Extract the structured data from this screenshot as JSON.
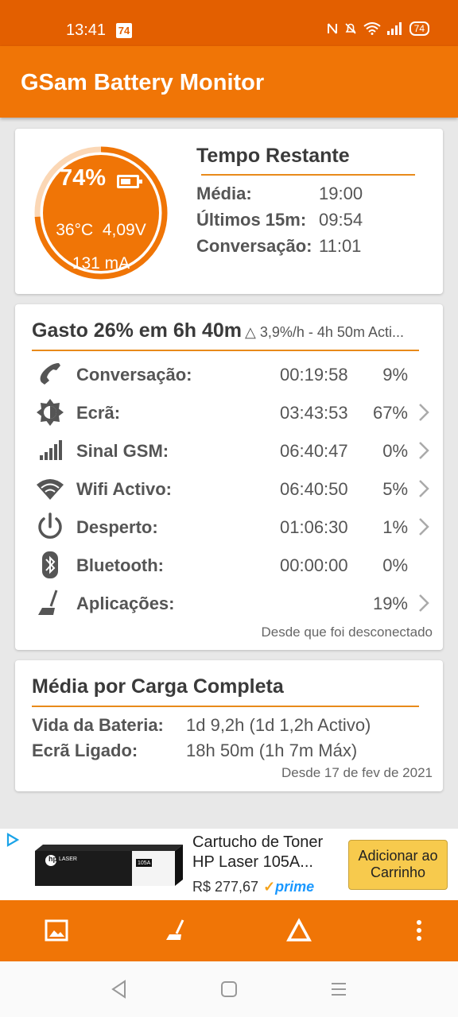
{
  "status_bar": {
    "time": "13:41",
    "badge": "74",
    "battery": "74"
  },
  "app_bar": {
    "title": "GSam Battery Monitor"
  },
  "battery_card": {
    "percent": "74%",
    "temp_voltage": "36°C  4,09V",
    "current": "131 mA",
    "level": 0.74,
    "time_remaining": {
      "title": "Tempo Restante",
      "rows": [
        {
          "label": "Média:",
          "value": "19:00"
        },
        {
          "label": "Últimos 15m:",
          "value": "09:54"
        },
        {
          "label": "Conversação:",
          "value": "11:01"
        }
      ]
    }
  },
  "usage_card": {
    "headline": "Gasto 26% em 6h 40m",
    "subline": "△ 3,9%/h - 4h 50m Acti...",
    "rows": [
      {
        "icon": "phone-icon",
        "label": "Conversação:",
        "time": "00:19:58",
        "percent": "9%",
        "chevron": false
      },
      {
        "icon": "brightness-icon",
        "label": "Ecrã:",
        "time": "03:43:53",
        "percent": "67%",
        "chevron": true
      },
      {
        "icon": "signal-icon",
        "label": "Sinal GSM:",
        "time": "06:40:47",
        "percent": "0%",
        "chevron": true
      },
      {
        "icon": "wifi-icon",
        "label": "Wifi Activo:",
        "time": "06:40:50",
        "percent": "5%",
        "chevron": true
      },
      {
        "icon": "power-icon",
        "label": "Desperto:",
        "time": "01:06:30",
        "percent": "1%",
        "chevron": true
      },
      {
        "icon": "bluetooth-icon",
        "label": "Bluetooth:",
        "time": "00:00:00",
        "percent": "0%",
        "chevron": false
      },
      {
        "icon": "broom-icon",
        "label": "Aplicações:",
        "time": "",
        "percent": "19%",
        "chevron": true
      }
    ],
    "footer": "Desde que foi desconectado"
  },
  "average_card": {
    "title": "Média por Carga Completa",
    "rows": [
      {
        "label": "Vida da Bateria:",
        "value": "1d 9,2h (1d 1,2h Activo)"
      },
      {
        "label": "Ecrã Ligado:",
        "value": "18h 50m (1h 7m Máx)"
      }
    ],
    "footer": "Desde 17 de fev de 2021"
  },
  "ad": {
    "title": "Cartucho de Toner HP Laser 105A...",
    "price": "R$ 277,67",
    "check": "✓",
    "prime": "prime",
    "button": "Adicionar ao Carrinho",
    "product_brand": "hp",
    "product_line": "LASER",
    "product_code": "105A"
  },
  "bottom_bar": {
    "icons": [
      "image-icon",
      "broom-icon",
      "delta-icon",
      "more-vert-icon"
    ]
  },
  "colors": {
    "primary": "#f07506",
    "status": "#e35f00",
    "accent_line": "#e88a1a",
    "gauge": "#f07506"
  }
}
